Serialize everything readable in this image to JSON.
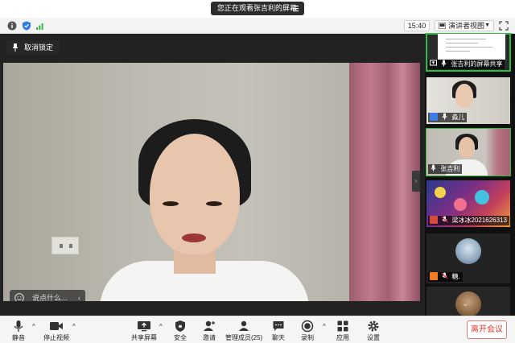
{
  "share_banner": {
    "text": "您正在观看张吉利的屏幕",
    "menu_icon": "menu-lines-icon"
  },
  "infobar": {
    "icons": [
      "info-icon",
      "shield-check-icon",
      "signal-bars-icon"
    ],
    "time": "15:40",
    "view_button": "演讲者视图",
    "fullscreen_icon": "fullscreen-icon"
  },
  "stage": {
    "unlock_label": "取消锁定",
    "chat_placeholder": "说点什么...",
    "collapse_arrow": "›"
  },
  "gallery": {
    "tiles": [
      {
        "name": "张吉利的屏幕共享",
        "avatar": "none",
        "muted": false
      },
      {
        "name": "淼儿",
        "avatar": "blue",
        "muted": false
      },
      {
        "name": "张吉利",
        "avatar": "none",
        "muted": false
      },
      {
        "name": "梁冰冰2021626313",
        "avatar": "red",
        "muted": true
      },
      {
        "name": "糖.",
        "avatar": "orange",
        "muted": true
      }
    ],
    "more_arrow": "⌄"
  },
  "toolbar": {
    "mute": "静音",
    "stop_video": "停止视频",
    "share_screen": "共享屏幕",
    "security": "安全",
    "invite": "邀请",
    "participants": "管理成员(25)",
    "chat": "聊天",
    "record": "录制",
    "apps": "应用",
    "settings": "设置",
    "leave": "离开会议"
  },
  "colors": {
    "active_speaker": "#2fbf3e",
    "leave_text": "#d93a2f"
  }
}
